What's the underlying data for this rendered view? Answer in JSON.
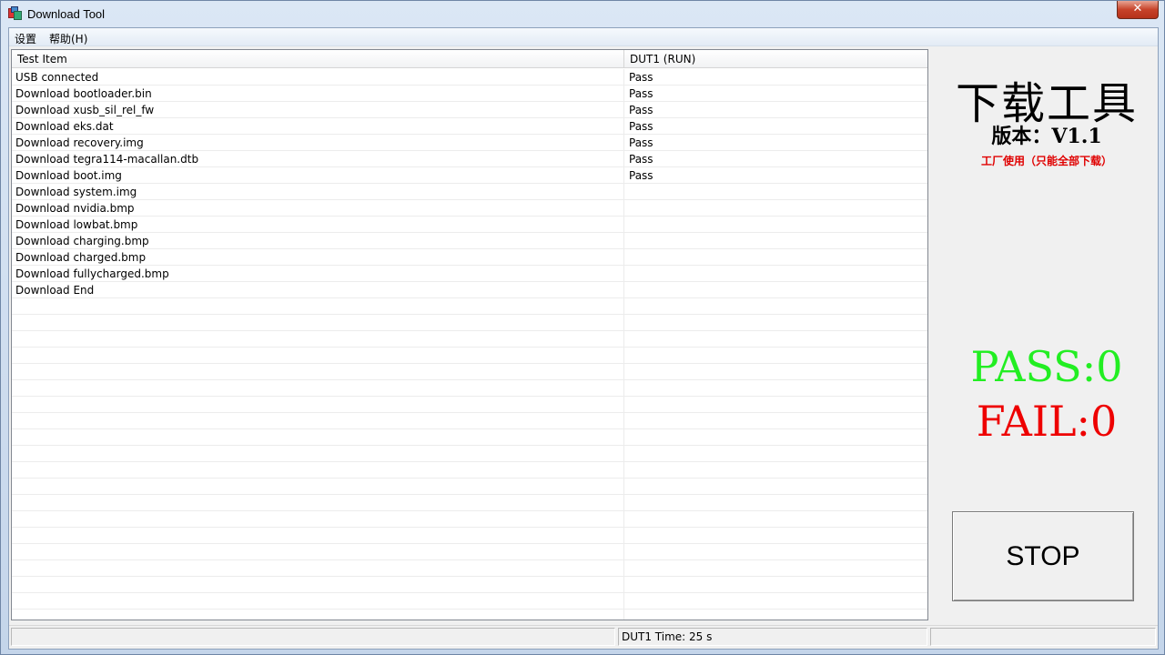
{
  "window": {
    "title": "Download Tool",
    "close_label": "✕"
  },
  "menu": {
    "items": [
      "设置",
      "帮助(H)"
    ]
  },
  "grid": {
    "headers": [
      "Test Item",
      "DUT1  (RUN)"
    ],
    "rows": [
      {
        "item": "USB connected",
        "result": "Pass"
      },
      {
        "item": "Download bootloader.bin",
        "result": "Pass"
      },
      {
        "item": "Download xusb_sil_rel_fw",
        "result": "Pass"
      },
      {
        "item": "Download eks.dat",
        "result": "Pass"
      },
      {
        "item": "Download recovery.img",
        "result": "Pass"
      },
      {
        "item": "Download tegra114-macallan.dtb",
        "result": "Pass"
      },
      {
        "item": "Download boot.img",
        "result": "Pass"
      },
      {
        "item": "Download system.img",
        "result": ""
      },
      {
        "item": "Download nvidia.bmp",
        "result": ""
      },
      {
        "item": "Download lowbat.bmp",
        "result": ""
      },
      {
        "item": "Download charging.bmp",
        "result": ""
      },
      {
        "item": "Download charged.bmp",
        "result": ""
      },
      {
        "item": "Download fullycharged.bmp",
        "result": ""
      },
      {
        "item": "Download End",
        "result": ""
      }
    ]
  },
  "panel": {
    "title": "下载工具",
    "version": "版本：V1.1",
    "note": "工厂使用（只能全部下载）",
    "pass": "PASS:0",
    "fail": "FAIL:0",
    "stop_label": "STOP"
  },
  "status": {
    "pane1": "",
    "pane2": "DUT1 Time: 25 s",
    "pane3": ""
  },
  "colors": {
    "pass": "#22ee22",
    "fail": "#ee0000",
    "note": "#e00000"
  }
}
